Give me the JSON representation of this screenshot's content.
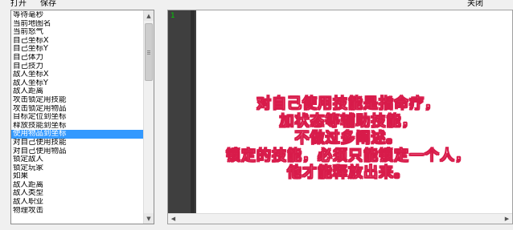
{
  "toolbar": {
    "open_label": "打开",
    "save_label": "保存",
    "close_label": "关闭"
  },
  "list": {
    "selected_index": 14,
    "items": [
      "等待毫秒",
      "当前地图名",
      "当前怒气",
      "自己坐标X",
      "自己坐标Y",
      "自己体力",
      "自己技力",
      "敌人坐标X",
      "敌人坐标Y",
      "敌人距离",
      "攻击锁定用技能",
      "攻击锁定用物品",
      "目标定位到坐标",
      "释放技能到坐标",
      "使用物品到坐标",
      "对自己使用技能",
      "对自己使用物品",
      "锁定敌人",
      "锁定玩家",
      "如果",
      "敌人距离",
      "敌人类型",
      "敌人职业",
      "物理攻击"
    ]
  },
  "editor": {
    "line_number": "1"
  },
  "overlay": {
    "lines": [
      "对自己使用技能是指命疗，",
      "加状态等辅助技能，",
      "不做过多阐述。",
      "锁定的技能，必须只能锁定一个人，",
      "他才能释放出来。"
    ],
    "text_color": "#ffe1e8",
    "outline_color": "#d81b4a"
  },
  "colors": {
    "selection": "#3399ff",
    "line_number": "#00d000",
    "gutter": "#3f3f3f"
  }
}
